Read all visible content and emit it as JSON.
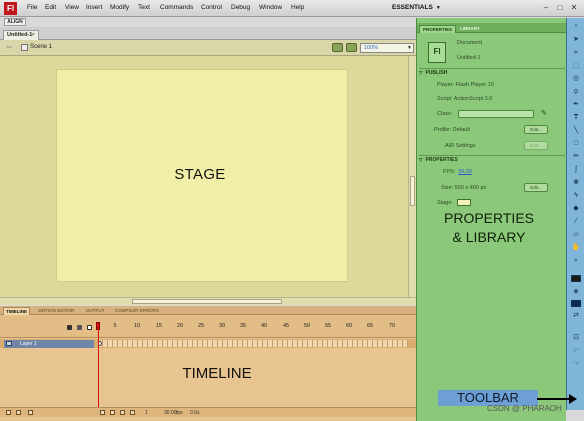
{
  "app": {
    "logo": "Fl"
  },
  "menu": {
    "items": [
      "File",
      "Edit",
      "View",
      "Insert",
      "Modify",
      "Text",
      "Commands",
      "Control",
      "Debug",
      "Window",
      "Help"
    ],
    "workspace": "ESSENTIALS",
    "window_controls": [
      "–",
      "□",
      "✕"
    ]
  },
  "left_dock": {
    "align_tab": "ALIGN"
  },
  "document": {
    "tab_label": "Untitled-1",
    "tab_close": "×"
  },
  "edit_bar": {
    "scene_label": "Scene 1",
    "zoom": "100%"
  },
  "stage": {
    "label": "STAGE",
    "color": "#f1efa7"
  },
  "timeline": {
    "tabs": [
      "TIMELINE",
      "MOTION EDITOR",
      "OUTPUT",
      "COMPILER ERRORS"
    ],
    "ruler": [
      "5",
      "10",
      "15",
      "20",
      "25",
      "30",
      "35",
      "40",
      "45",
      "50",
      "55",
      "60",
      "65",
      "70"
    ],
    "layer_name": "Layer 1",
    "label": "TIMELINE",
    "status": {
      "frame": "1",
      "fps": "30.00",
      "fps_unit": "fps",
      "time": "0.0s"
    }
  },
  "properties": {
    "tabs": [
      "PROPERTIES",
      "LIBRARY"
    ],
    "doc_icon": "Fl",
    "doc_type": "Document",
    "doc_name": "Untitled-1",
    "publish_header": "PUBLISH",
    "player": "Player: Flash Player 10",
    "script": "Script: ActionScript 3.0",
    "class_label": "Class:",
    "profile": "Profile: Default",
    "edit_button": "Edit...",
    "air_settings": "AIR Settings",
    "props_header": "PROPERTIES",
    "fps_label": "FPS:",
    "fps_value": "30.00",
    "size": "Size: 550 x 400 px",
    "stage_label": "Stage:",
    "stage_color": "#f4f3b6",
    "big_label_line1": "PROPERTIES",
    "big_label_line2": "& LIBRARY"
  },
  "toolbar": {
    "label": "TOOLBAR",
    "tools": [
      "selection-icon",
      "subselection-icon",
      "free-transform-icon",
      "3d-rotation-icon",
      "lasso-icon",
      "pen-icon",
      "text-icon",
      "line-icon",
      "rectangle-icon",
      "pencil-icon",
      "brush-icon",
      "deco-icon",
      "bone-icon",
      "paint-bucket-icon",
      "eyedropper-icon",
      "eraser-icon",
      "hand-icon",
      "zoom-icon"
    ],
    "stroke_color": "#1a1a1a",
    "fill_color": "#0b2a55"
  },
  "watermark": "CSDN @ PHARAOH"
}
